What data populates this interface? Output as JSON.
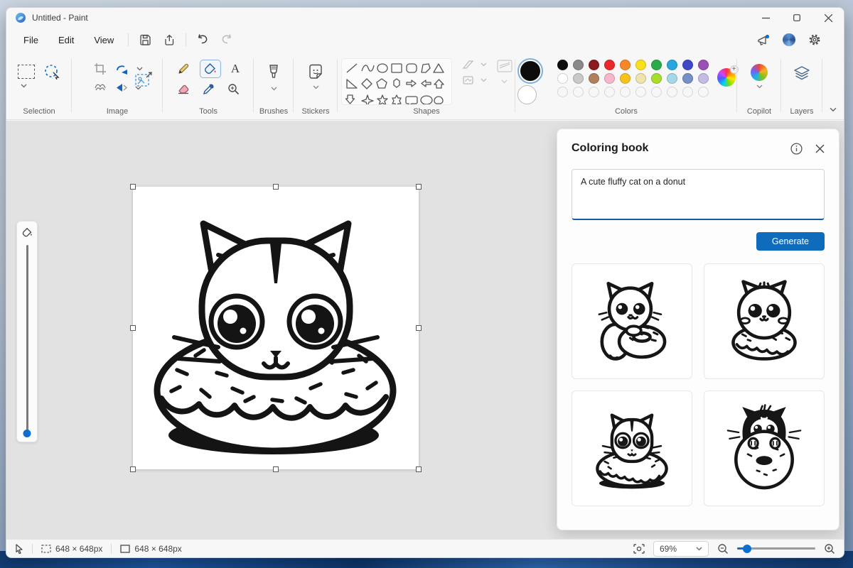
{
  "window": {
    "title": "Untitled - Paint"
  },
  "menubar": {
    "items": [
      {
        "label": "File"
      },
      {
        "label": "Edit"
      },
      {
        "label": "View"
      }
    ]
  },
  "ribbon": {
    "sections": [
      {
        "label": "Selection"
      },
      {
        "label": "Image"
      },
      {
        "label": "Tools"
      },
      {
        "label": "Brushes"
      },
      {
        "label": "Stickers"
      },
      {
        "label": "Shapes"
      },
      {
        "label": "Colors"
      },
      {
        "label": "Copilot"
      },
      {
        "label": "Layers"
      }
    ],
    "tools": {
      "text_glyph": "A"
    },
    "palette": {
      "color1": "#0c0c0c",
      "color2": "#ffffff",
      "row1": [
        "#0c0c0c",
        "#8a8a8a",
        "#8b1a1f",
        "#e8282b",
        "#f7882a",
        "#f9e01e",
        "#2bab47",
        "#28a6df",
        "#3d49c4",
        "#9b4fb5"
      ],
      "row2": [
        "#ffffff",
        "#c9c9c9",
        "#b0805e",
        "#f6b6cb",
        "#f9c21a",
        "#efe3ae",
        "#a8dd2b",
        "#a5d8e8",
        "#7590c8",
        "#c5bce4"
      ]
    }
  },
  "panel": {
    "title": "Coloring book",
    "prompt": "A cute fluffy cat on a donut",
    "generate": "Generate",
    "thumbnails": [
      {
        "name": "cat-hugging-donut"
      },
      {
        "name": "round-cat-on-donut"
      },
      {
        "name": "cat-inside-donut"
      },
      {
        "name": "tuxedo-cat-behind-donut"
      }
    ]
  },
  "statusbar": {
    "selection_size": "648 × 648px",
    "image_size": "648 × 648px",
    "zoom": "69%"
  }
}
